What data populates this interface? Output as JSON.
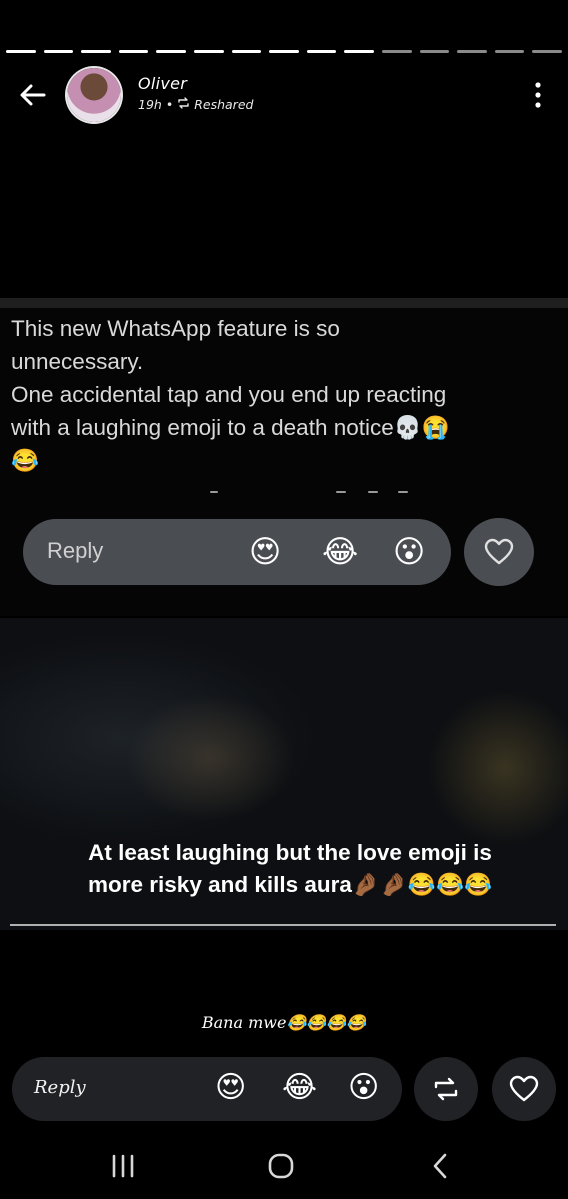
{
  "story": {
    "progress": {
      "segments": 15,
      "completed": 10
    },
    "author": {
      "name": "Oliver",
      "time": "19h",
      "status": "Reshared"
    },
    "caption": "Bana mwe😂😂😂😂"
  },
  "shared_screenshot_1": {
    "text_lines": [
      "This new WhatsApp feature is so",
      "unnecessary.",
      "One accidental tap and you end up reacting",
      "with a laughing emoji to a death notice💀😭",
      "😂"
    ],
    "reply_label": "Reply",
    "reactions": [
      "😍",
      "😂",
      "😮"
    ]
  },
  "shared_screenshot_2": {
    "text_lines": [
      "At least laughing but the love emoji is",
      "more risky and kills aura🤌🏾🤌🏾😂😂😂"
    ]
  },
  "reply_bar": {
    "label": "Reply",
    "reactions": [
      "😍",
      "😂",
      "😮"
    ]
  },
  "icons": {
    "back": "back-arrow-icon",
    "menu": "more-vertical-icon",
    "reshare": "reshare-icon",
    "like": "heart-icon",
    "nav_recents": "recents-icon",
    "nav_home": "home-icon",
    "nav_back": "nav-back-icon"
  },
  "colors": {
    "background": "#000000",
    "bar": "#202226",
    "embedded_bar": "#4a4d52"
  }
}
